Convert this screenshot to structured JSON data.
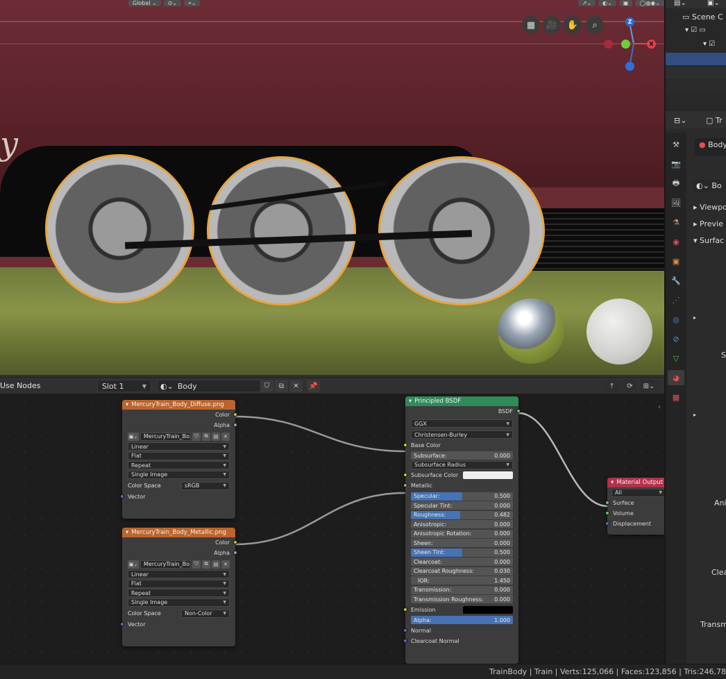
{
  "viewport": {
    "header_transform": "Global",
    "gizmo": {
      "z_label": "Z",
      "x_label": "X"
    },
    "script_letter": "y"
  },
  "node_editor": {
    "use_nodes_label": "Use Nodes",
    "slot": "Slot 1",
    "material_name": "Body"
  },
  "nodes": {
    "diffuse": {
      "title": "MercuryTrain_Body_Diffuse.png",
      "out_color": "Color",
      "out_alpha": "Alpha",
      "image_name": "MercuryTrain_Bo...",
      "interpolation": "Linear",
      "projection": "Flat",
      "extension": "Repeat",
      "source": "Single Image",
      "color_space_label": "Color Space",
      "color_space": "sRGB",
      "vector": "Vector"
    },
    "metallic": {
      "title": "MercuryTrain_Body_Metallic.png",
      "out_color": "Color",
      "out_alpha": "Alpha",
      "image_name": "MercuryTrain_Bo...",
      "interpolation": "Linear",
      "projection": "Flat",
      "extension": "Repeat",
      "source": "Single Image",
      "color_space_label": "Color Space",
      "color_space": "Non-Color",
      "vector": "Vector"
    },
    "bsdf": {
      "title": "Principled BSDF",
      "output": "BSDF",
      "distribution": "GGX",
      "subsurface_method": "Christensen-Burley",
      "base_color": "Base Color",
      "subsurface": {
        "label": "Subsurface:",
        "value": "0.000"
      },
      "subsurface_radius": "Subsurface Radius",
      "subsurface_color": "Subsurface Color",
      "metallic": "Metallic",
      "specular": {
        "label": "Specular:",
        "value": "0.500",
        "fill": 0.5
      },
      "specular_tint": {
        "label": "Specular Tint:",
        "value": "0.000"
      },
      "roughness": {
        "label": "Roughness:",
        "value": "0.482",
        "fill": 0.482
      },
      "anisotropic": {
        "label": "Anisotropic:",
        "value": "0.000"
      },
      "anisotropic_rotation": {
        "label": "Anisotropic Rotation:",
        "value": "0.000"
      },
      "sheen": {
        "label": "Sheen:",
        "value": "0.000"
      },
      "sheen_tint": {
        "label": "Sheen Tint:",
        "value": "0.500",
        "fill": 0.5
      },
      "clearcoat": {
        "label": "Clearcoat:",
        "value": "0.000"
      },
      "clearcoat_roughness": {
        "label": "Clearcoat Roughness:",
        "value": "0.030"
      },
      "ior": {
        "label": "IOR:",
        "value": "1.450"
      },
      "transmission": {
        "label": "Transmission:",
        "value": "0.000"
      },
      "transmission_roughness": {
        "label": "Transmission Roughness:",
        "value": "0.000"
      },
      "emission": "Emission",
      "alpha": {
        "label": "Alpha:",
        "value": "1.000",
        "fill": 1.0
      },
      "normal": "Normal",
      "clearcoat_normal": "Clearcoat Normal"
    },
    "output": {
      "title": "Material Output",
      "target": "All",
      "surface": "Surface",
      "volume": "Volume",
      "displacement": "Displacement"
    }
  },
  "outliner": {
    "scene_collection": "Scene C"
  },
  "properties": {
    "header_name": "Tr",
    "material_slot": "Body",
    "material_name": "Bo",
    "panels": [
      "Viewpo",
      "Previe",
      "Surfac"
    ],
    "side_labels": [
      "S",
      "Anis",
      "Clea",
      "Transmi"
    ]
  },
  "status": "TrainBody | Train | Verts:125,066 | Faces:123,856 | Tris:246,78",
  "colors": {
    "accent": "#4772b3",
    "texture_header": "#b9652d",
    "shader_header": "#2e8b5a",
    "output_header": "#b3314a"
  }
}
